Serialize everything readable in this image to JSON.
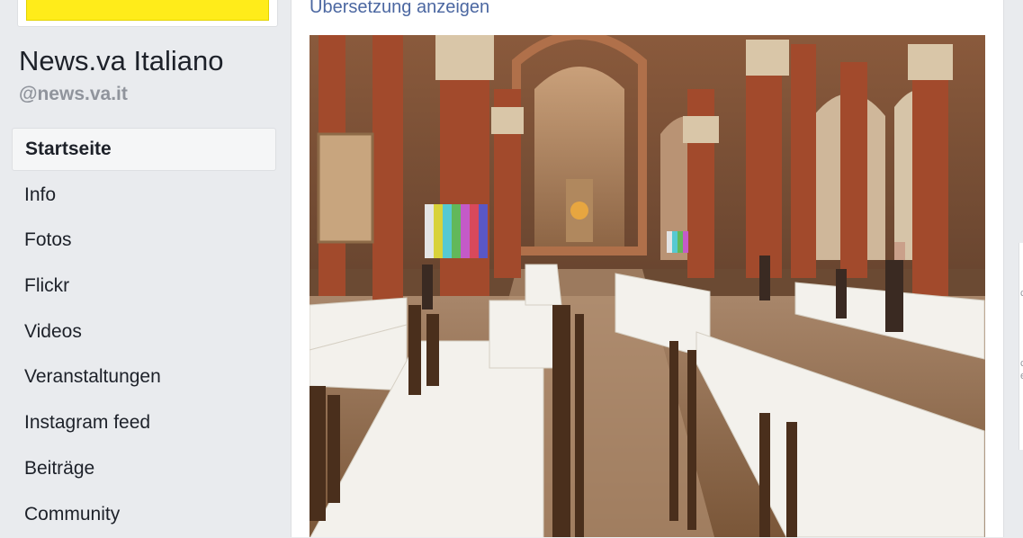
{
  "page": {
    "name": "News.va Italiano",
    "handle": "@news.va.it"
  },
  "nav": {
    "items": [
      {
        "label": "Startseite",
        "active": true
      },
      {
        "label": "Info"
      },
      {
        "label": "Fotos"
      },
      {
        "label": "Flickr"
      },
      {
        "label": "Videos"
      },
      {
        "label": "Veranstaltungen"
      },
      {
        "label": "Instagram feed"
      },
      {
        "label": "Beiträge"
      },
      {
        "label": "Community"
      }
    ]
  },
  "post": {
    "translate_label": "Übersetzung anzeigen"
  },
  "right_edge": {
    "fragments": [
      "c",
      "ci",
      "e"
    ]
  },
  "colors": {
    "page_bg": "#e9ebee",
    "link_blue": "#4b67a1",
    "text_dark": "#1d2129",
    "text_gray": "#90949c",
    "profile_yellow": "#ffec1a"
  }
}
